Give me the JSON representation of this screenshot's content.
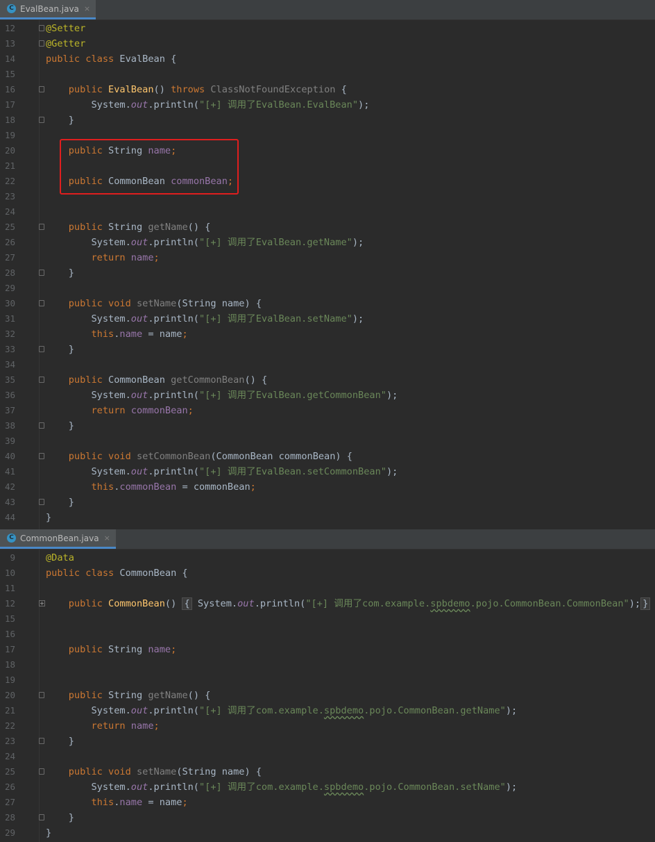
{
  "editor_top": {
    "tab": {
      "label": "EvalBean.java",
      "icon": "class-icon",
      "close": "×"
    },
    "lines": [
      {
        "n": "12",
        "parts": [
          [
            "a",
            "@Setter"
          ]
        ],
        "fold": "start"
      },
      {
        "n": "13",
        "parts": [
          [
            "a",
            "@Getter"
          ]
        ],
        "fold": "start"
      },
      {
        "n": "14",
        "parts": [
          [
            "k",
            "public class "
          ],
          [
            "t",
            "EvalBean {"
          ]
        ]
      },
      {
        "n": "15",
        "parts": []
      },
      {
        "n": "16",
        "parts": [
          [
            "t",
            "    "
          ],
          [
            "k",
            "public "
          ],
          [
            "m",
            "EvalBean"
          ],
          [
            "t",
            "() "
          ],
          [
            "k",
            "throws "
          ],
          [
            "g",
            "ClassNotFoundException"
          ],
          [
            "t",
            " {"
          ]
        ],
        "fold": "start"
      },
      {
        "n": "17",
        "parts": [
          [
            "t",
            "        System."
          ],
          [
            "fi",
            "out"
          ],
          [
            "t",
            ".println("
          ],
          [
            "s",
            "\"[+] 调用了EvalBean.EvalBean\""
          ],
          [
            "t",
            ");"
          ]
        ]
      },
      {
        "n": "18",
        "parts": [
          [
            "t",
            "    }"
          ]
        ],
        "fold": "end"
      },
      {
        "n": "19",
        "parts": []
      },
      {
        "n": "20",
        "parts": [
          [
            "t",
            "    "
          ],
          [
            "k",
            "public "
          ],
          [
            "t",
            "String "
          ],
          [
            "f",
            "name"
          ],
          [
            "k",
            ";"
          ]
        ]
      },
      {
        "n": "21",
        "parts": []
      },
      {
        "n": "22",
        "parts": [
          [
            "t",
            "    "
          ],
          [
            "k",
            "public "
          ],
          [
            "t",
            "CommonBean "
          ],
          [
            "f",
            "commonBean"
          ],
          [
            "k",
            ";"
          ]
        ]
      },
      {
        "n": "23",
        "parts": []
      },
      {
        "n": "24",
        "parts": []
      },
      {
        "n": "25",
        "parts": [
          [
            "t",
            "    "
          ],
          [
            "k",
            "public "
          ],
          [
            "t",
            "String "
          ],
          [
            "g",
            "getName"
          ],
          [
            "t",
            "() {"
          ]
        ],
        "fold": "start"
      },
      {
        "n": "26",
        "parts": [
          [
            "t",
            "        System."
          ],
          [
            "fi",
            "out"
          ],
          [
            "t",
            ".println("
          ],
          [
            "s",
            "\"[+] 调用了EvalBean.getName\""
          ],
          [
            "t",
            ");"
          ]
        ]
      },
      {
        "n": "27",
        "parts": [
          [
            "t",
            "        "
          ],
          [
            "k",
            "return "
          ],
          [
            "f",
            "name"
          ],
          [
            "k",
            ";"
          ]
        ]
      },
      {
        "n": "28",
        "parts": [
          [
            "t",
            "    }"
          ]
        ],
        "fold": "end"
      },
      {
        "n": "29",
        "parts": []
      },
      {
        "n": "30",
        "parts": [
          [
            "t",
            "    "
          ],
          [
            "k",
            "public void "
          ],
          [
            "g",
            "setName"
          ],
          [
            "t",
            "(String name) {"
          ]
        ],
        "fold": "start"
      },
      {
        "n": "31",
        "parts": [
          [
            "t",
            "        System."
          ],
          [
            "fi",
            "out"
          ],
          [
            "t",
            ".println("
          ],
          [
            "s",
            "\"[+] 调用了EvalBean.setName\""
          ],
          [
            "t",
            ");"
          ]
        ]
      },
      {
        "n": "32",
        "parts": [
          [
            "t",
            "        "
          ],
          [
            "k",
            "this"
          ],
          [
            "t",
            "."
          ],
          [
            "f",
            "name"
          ],
          [
            "t",
            " = name"
          ],
          [
            "k",
            ";"
          ]
        ]
      },
      {
        "n": "33",
        "parts": [
          [
            "t",
            "    }"
          ]
        ],
        "fold": "end"
      },
      {
        "n": "34",
        "parts": []
      },
      {
        "n": "35",
        "parts": [
          [
            "t",
            "    "
          ],
          [
            "k",
            "public "
          ],
          [
            "t",
            "CommonBean "
          ],
          [
            "g",
            "getCommonBean"
          ],
          [
            "t",
            "() {"
          ]
        ],
        "fold": "start"
      },
      {
        "n": "36",
        "parts": [
          [
            "t",
            "        System."
          ],
          [
            "fi",
            "out"
          ],
          [
            "t",
            ".println("
          ],
          [
            "s",
            "\"[+] 调用了EvalBean.getCommonBean\""
          ],
          [
            "t",
            ");"
          ]
        ]
      },
      {
        "n": "37",
        "parts": [
          [
            "t",
            "        "
          ],
          [
            "k",
            "return "
          ],
          [
            "f",
            "commonBean"
          ],
          [
            "k",
            ";"
          ]
        ]
      },
      {
        "n": "38",
        "parts": [
          [
            "t",
            "    }"
          ]
        ],
        "fold": "end"
      },
      {
        "n": "39",
        "parts": []
      },
      {
        "n": "40",
        "parts": [
          [
            "t",
            "    "
          ],
          [
            "k",
            "public void "
          ],
          [
            "g",
            "setCommonBean"
          ],
          [
            "t",
            "(CommonBean commonBean) {"
          ]
        ],
        "fold": "start"
      },
      {
        "n": "41",
        "parts": [
          [
            "t",
            "        System."
          ],
          [
            "fi",
            "out"
          ],
          [
            "t",
            ".println("
          ],
          [
            "s",
            "\"[+] 调用了EvalBean.setCommonBean\""
          ],
          [
            "t",
            ");"
          ]
        ]
      },
      {
        "n": "42",
        "parts": [
          [
            "t",
            "        "
          ],
          [
            "k",
            "this"
          ],
          [
            "t",
            "."
          ],
          [
            "f",
            "commonBean"
          ],
          [
            "t",
            " = commonBean"
          ],
          [
            "k",
            ";"
          ]
        ]
      },
      {
        "n": "43",
        "parts": [
          [
            "t",
            "    }"
          ]
        ],
        "fold": "end"
      },
      {
        "n": "44",
        "parts": [
          [
            "t",
            "}"
          ]
        ]
      }
    ]
  },
  "editor_bottom": {
    "tab": {
      "label": "CommonBean.java",
      "icon": "class-icon",
      "close": "×"
    },
    "lines": [
      {
        "n": "9",
        "parts": [
          [
            "a",
            "@Data"
          ]
        ]
      },
      {
        "n": "10",
        "parts": [
          [
            "k",
            "public class "
          ],
          [
            "t",
            "CommonBean {"
          ]
        ]
      },
      {
        "n": "11",
        "parts": []
      },
      {
        "n": "12",
        "parts": [
          [
            "t",
            "    "
          ],
          [
            "k",
            "public "
          ],
          [
            "m",
            "CommonBean"
          ],
          [
            "t",
            "() "
          ],
          [
            "box",
            "{"
          ],
          [
            "t",
            " System."
          ],
          [
            "fi",
            "out"
          ],
          [
            "t",
            ".println("
          ],
          [
            "s",
            "\"[+] 调用了com.example."
          ],
          [
            "sq",
            "spbdemo"
          ],
          [
            "s",
            ".pojo.CommonBean.CommonBean\""
          ],
          [
            "t",
            ");"
          ],
          [
            "box",
            "}"
          ]
        ],
        "fold": "plus"
      },
      {
        "n": "15",
        "parts": []
      },
      {
        "n": "16",
        "parts": []
      },
      {
        "n": "17",
        "parts": [
          [
            "t",
            "    "
          ],
          [
            "k",
            "public "
          ],
          [
            "t",
            "String "
          ],
          [
            "f",
            "name"
          ],
          [
            "k",
            ";"
          ]
        ]
      },
      {
        "n": "18",
        "parts": []
      },
      {
        "n": "19",
        "parts": []
      },
      {
        "n": "20",
        "parts": [
          [
            "t",
            "    "
          ],
          [
            "k",
            "public "
          ],
          [
            "t",
            "String "
          ],
          [
            "g",
            "getName"
          ],
          [
            "t",
            "() {"
          ]
        ],
        "fold": "start"
      },
      {
        "n": "21",
        "parts": [
          [
            "t",
            "        System."
          ],
          [
            "fi",
            "out"
          ],
          [
            "t",
            ".println("
          ],
          [
            "s",
            "\"[+] 调用了com.example."
          ],
          [
            "sq",
            "spbdemo"
          ],
          [
            "s",
            ".pojo.CommonBean.getName\""
          ],
          [
            "t",
            ");"
          ]
        ]
      },
      {
        "n": "22",
        "parts": [
          [
            "t",
            "        "
          ],
          [
            "k",
            "return "
          ],
          [
            "f",
            "name"
          ],
          [
            "k",
            ";"
          ]
        ]
      },
      {
        "n": "23",
        "parts": [
          [
            "t",
            "    }"
          ]
        ],
        "fold": "end"
      },
      {
        "n": "24",
        "parts": []
      },
      {
        "n": "25",
        "parts": [
          [
            "t",
            "    "
          ],
          [
            "k",
            "public void "
          ],
          [
            "g",
            "setName"
          ],
          [
            "t",
            "(String name) {"
          ]
        ],
        "fold": "start"
      },
      {
        "n": "26",
        "parts": [
          [
            "t",
            "        System."
          ],
          [
            "fi",
            "out"
          ],
          [
            "t",
            ".println("
          ],
          [
            "s",
            "\"[+] 调用了com.example."
          ],
          [
            "sq",
            "spbdemo"
          ],
          [
            "s",
            ".pojo.CommonBean.setName\""
          ],
          [
            "t",
            ");"
          ]
        ]
      },
      {
        "n": "27",
        "parts": [
          [
            "t",
            "        "
          ],
          [
            "k",
            "this"
          ],
          [
            "t",
            "."
          ],
          [
            "f",
            "name"
          ],
          [
            "t",
            " = name"
          ],
          [
            "k",
            ";"
          ]
        ]
      },
      {
        "n": "28",
        "parts": [
          [
            "t",
            "    }"
          ]
        ],
        "fold": "end"
      },
      {
        "n": "29",
        "parts": [
          [
            "t",
            "}"
          ]
        ]
      }
    ]
  },
  "colors": {
    "background": "#2b2b2b",
    "keyword": "#cc7832",
    "annotation": "#bbb529",
    "field": "#9876aa",
    "string": "#6a8759",
    "method_decl": "#ffc66d",
    "highlight_box": "#e01e1e"
  }
}
